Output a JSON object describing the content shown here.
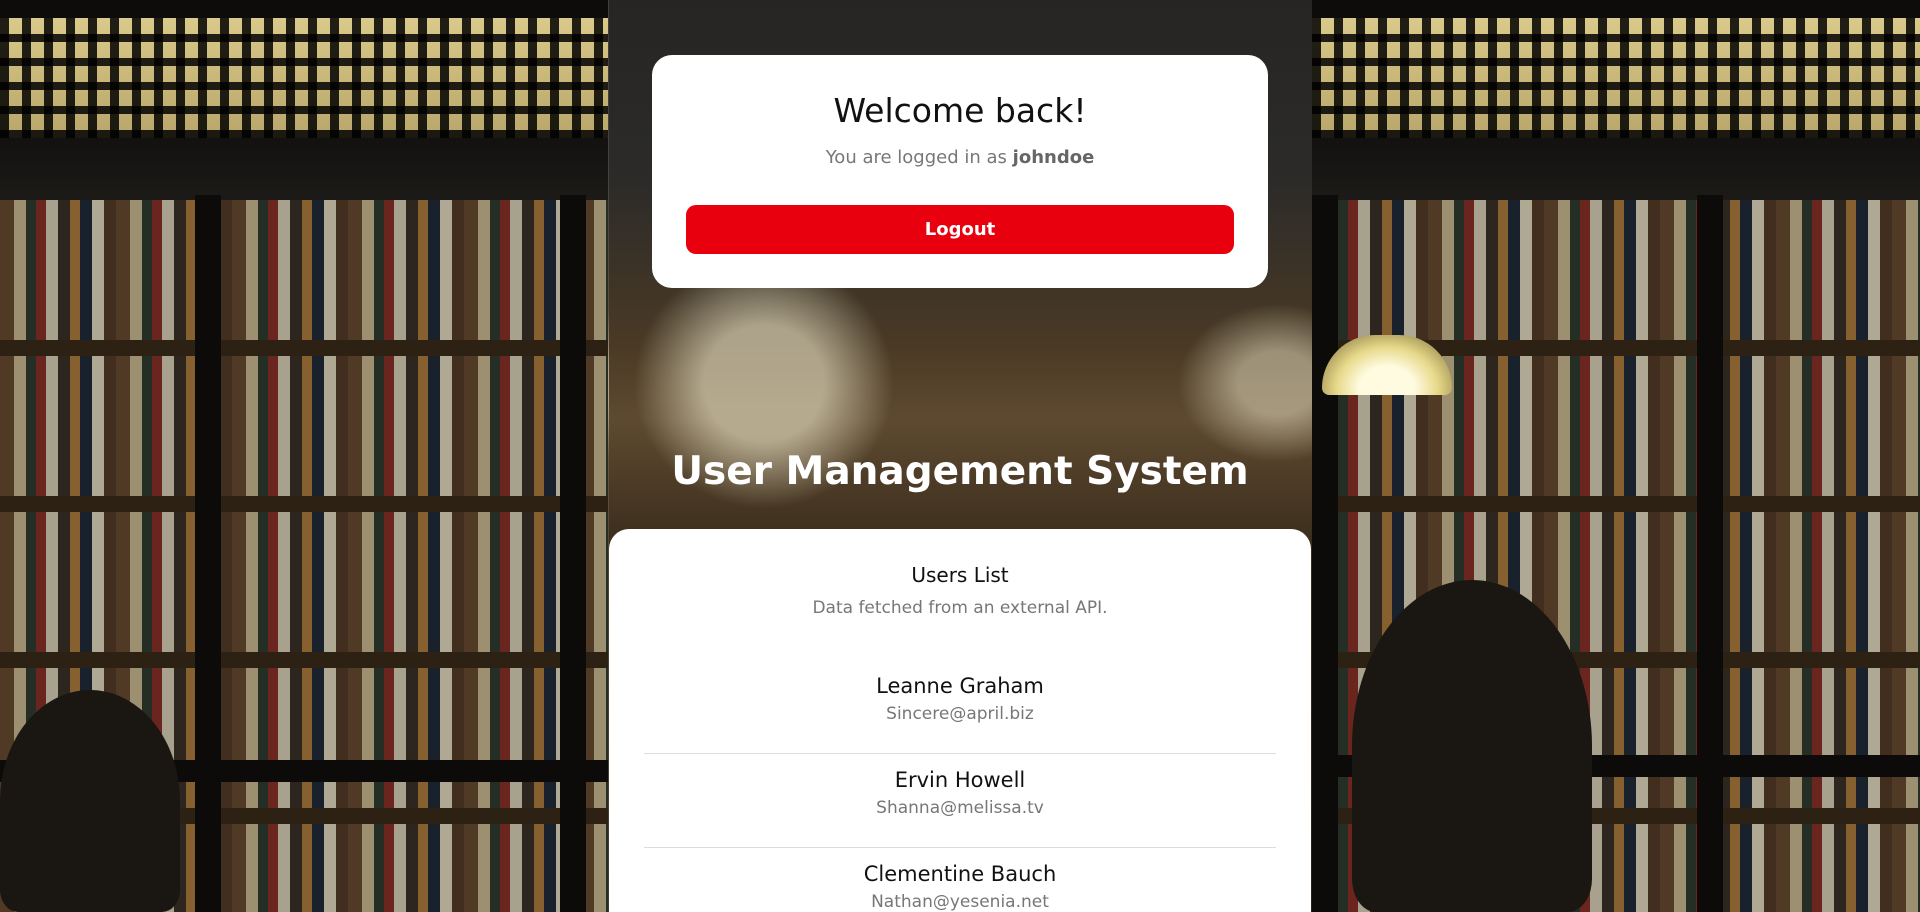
{
  "welcome": {
    "title": "Welcome back!",
    "logged_in_prefix": "You are logged in as",
    "username": "johndoe",
    "logout_label": "Logout"
  },
  "app": {
    "title": "User Management System"
  },
  "users": {
    "title": "Users List",
    "subtitle": "Data fetched from an external API.",
    "items": [
      {
        "name": "Leanne Graham",
        "email": "Sincere@april.biz"
      },
      {
        "name": "Ervin Howell",
        "email": "Shanna@melissa.tv"
      },
      {
        "name": "Clementine Bauch",
        "email": "Nathan@yesenia.net"
      }
    ]
  },
  "colors": {
    "accent": "#e8000f",
    "card_bg": "#ffffff",
    "title_text": "#ffffff"
  }
}
